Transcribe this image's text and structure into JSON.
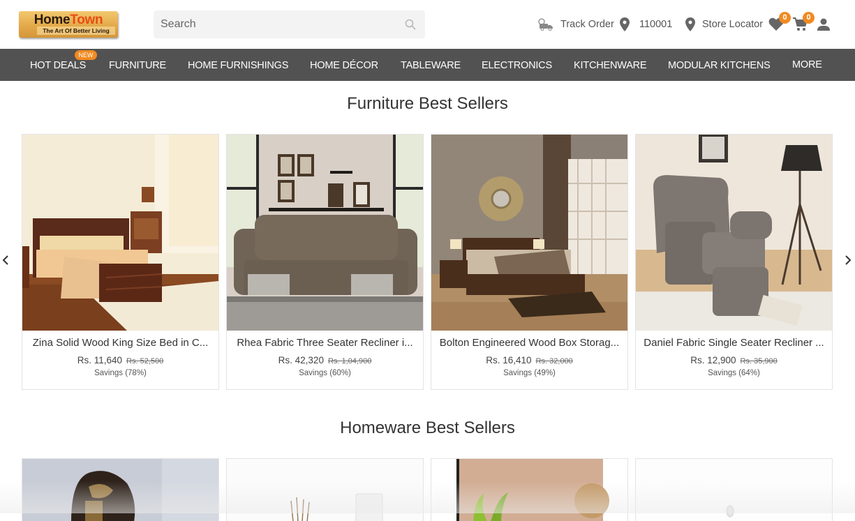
{
  "brand": {
    "name_part1": "Home",
    "name_part2": "Town",
    "tagline": "The Art Of Better Living"
  },
  "search": {
    "placeholder": "Search",
    "value": ""
  },
  "header_links": {
    "track_order": "Track Order",
    "pincode": "110001",
    "store_locator": "Store Locator",
    "wishlist_count": "0",
    "cart_count": "0"
  },
  "nav": {
    "new_badge": "NEW",
    "items": [
      {
        "label": "HOT DEALS"
      },
      {
        "label": "FURNITURE"
      },
      {
        "label": "HOME FURNISHINGS"
      },
      {
        "label": "HOME DÉCOR"
      },
      {
        "label": "TABLEWARE"
      },
      {
        "label": "ELECTRONICS"
      },
      {
        "label": "KITCHENWARE"
      },
      {
        "label": "MODULAR KITCHENS"
      },
      {
        "label": "MORE"
      }
    ]
  },
  "sections": [
    {
      "title": "Furniture Best Sellers",
      "products": [
        {
          "name": "Zina Solid Wood King Size Bed in C...",
          "price": "Rs. 11,640",
          "mrp": "Rs. 52,500",
          "savings": "Savings (78%)"
        },
        {
          "name": "Rhea Fabric Three Seater Recliner i...",
          "price": "Rs. 42,320",
          "mrp": "Rs. 1,04,900",
          "savings": "Savings (60%)"
        },
        {
          "name": "Bolton Engineered Wood Box Storag...",
          "price": "Rs. 16,410",
          "mrp": "Rs. 32,000",
          "savings": "Savings (49%)"
        },
        {
          "name": "Daniel Fabric Single Seater Recliner ...",
          "price": "Rs. 12,900",
          "mrp": "Rs. 35,900",
          "savings": "Savings (64%)"
        }
      ]
    },
    {
      "title": "Homeware Best Sellers"
    }
  ],
  "colors": {
    "accent": "#f18a21",
    "nav_bg": "#525252"
  }
}
